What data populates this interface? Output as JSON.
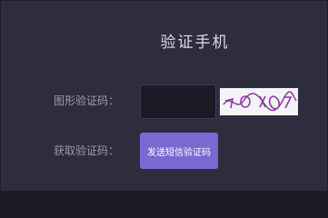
{
  "dialog": {
    "title": "验证手机"
  },
  "form": {
    "captcha_label": "图形验证码：",
    "captcha_value": "",
    "sms_label": "获取验证码：",
    "sms_button_label": "发送短信验证码"
  },
  "colors": {
    "background": "#2e2d3e",
    "input_background": "#1b1a27",
    "accent": "#7b68d0",
    "captcha_ink": "#8a3ca0"
  }
}
